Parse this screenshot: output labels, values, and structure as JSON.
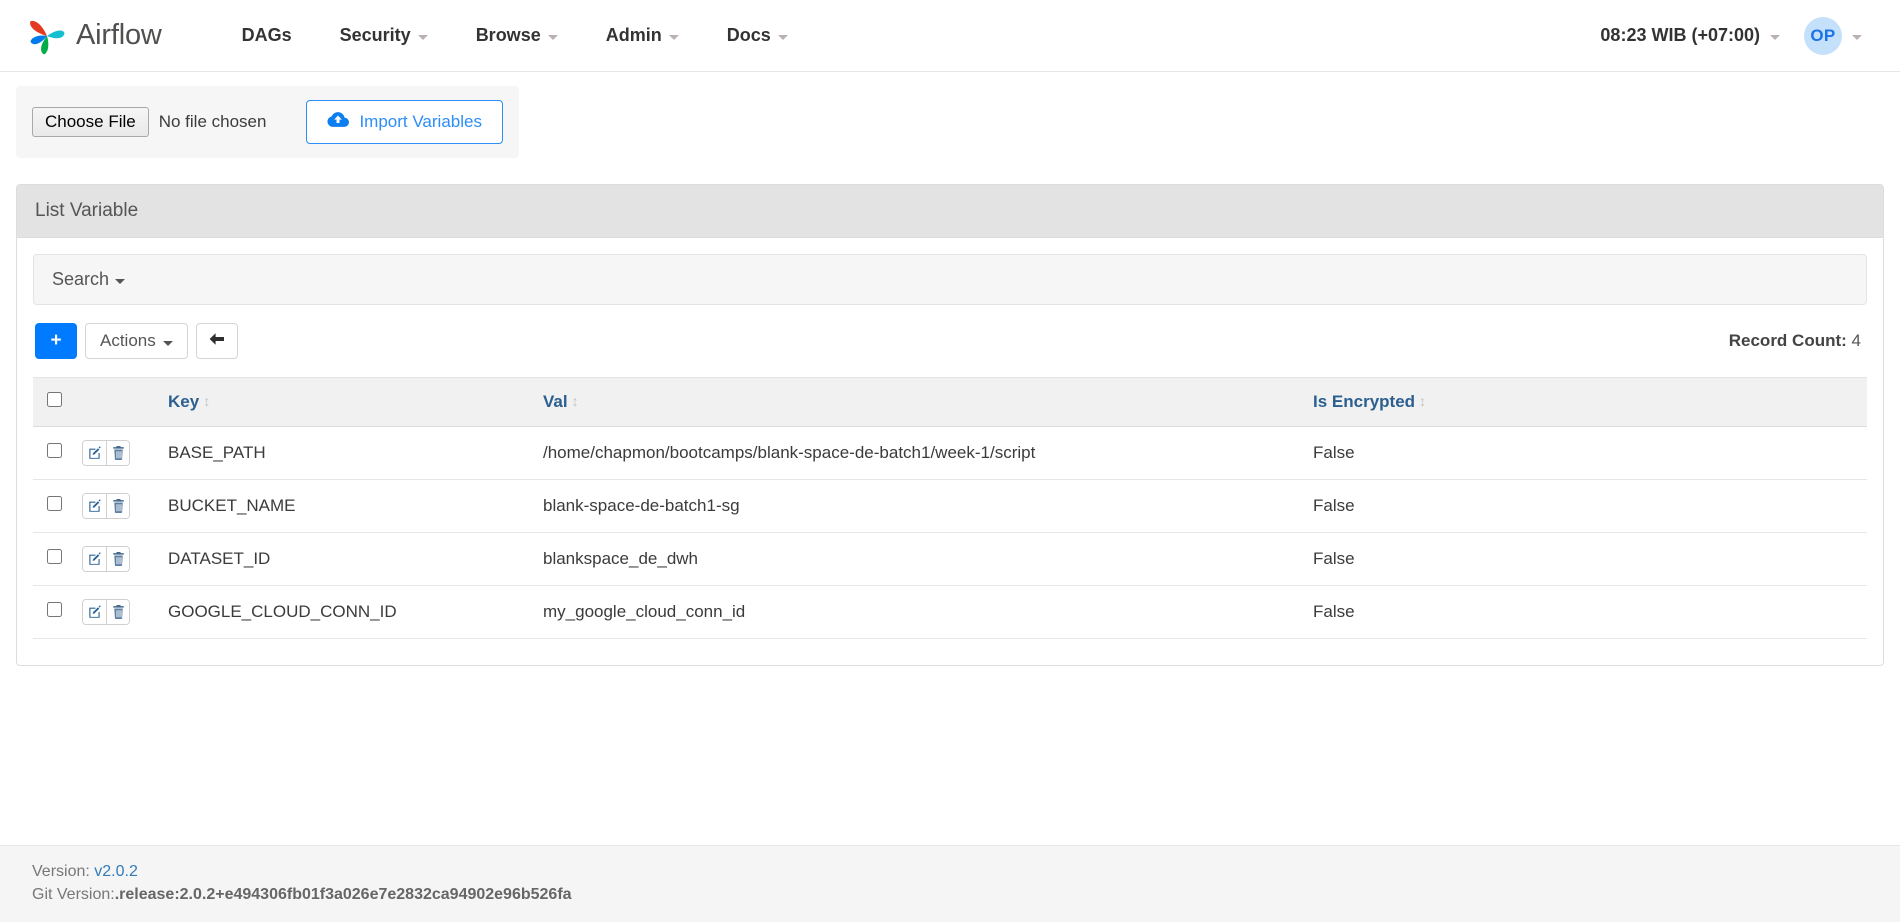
{
  "navbar": {
    "brand_label": "Airflow",
    "brand_logo_icon": "airflow-pinwheel-logo",
    "items": [
      {
        "label": "DAGs",
        "has_caret": false
      },
      {
        "label": "Security",
        "has_caret": true
      },
      {
        "label": "Browse",
        "has_caret": true
      },
      {
        "label": "Admin",
        "has_caret": true
      },
      {
        "label": "Docs",
        "has_caret": true
      }
    ],
    "clock_label": "08:23 WIB (+07:00)",
    "avatar_initials": "OP"
  },
  "import_bar": {
    "choose_file_label": "Choose File",
    "no_file_label": "No file chosen",
    "import_button_label": "Import Variables",
    "import_button_icon": "cloud-upload-icon"
  },
  "panel": {
    "heading": "List Variable",
    "search_label": "Search"
  },
  "toolbar": {
    "add_label": "+",
    "actions_label": "Actions",
    "back_icon": "arrow-left-icon",
    "record_count_label": "Record Count:",
    "record_count_value": "4"
  },
  "table": {
    "columns": [
      {
        "label": "Key",
        "sortable": true
      },
      {
        "label": "Val",
        "sortable": true
      },
      {
        "label": "Is Encrypted",
        "sortable": true
      }
    ],
    "row_actions": {
      "edit_icon": "edit-pencil-icon",
      "delete_icon": "trash-icon"
    },
    "rows": [
      {
        "key": "BASE_PATH",
        "val": "/home/chapmon/bootcamps/blank-space-de-batch1/week-1/script",
        "is_encrypted": "False"
      },
      {
        "key": "BUCKET_NAME",
        "val": "blank-space-de-batch1-sg",
        "is_encrypted": "False"
      },
      {
        "key": "DATASET_ID",
        "val": "blankspace_de_dwh",
        "is_encrypted": "False"
      },
      {
        "key": "GOOGLE_CLOUD_CONN_ID",
        "val": "my_google_cloud_conn_id",
        "is_encrypted": "False"
      }
    ]
  },
  "footer": {
    "version_label": "Version:",
    "version_value": "v2.0.2",
    "git_version_label": "Git Version:",
    "git_version_value": ".release:2.0.2+e494306fb01f3a026e7e2832ca94902e96b526fa"
  },
  "colors": {
    "accent_blue": "#007bff",
    "link_blue": "#337ab7",
    "header_blue": "#2b5f8f",
    "avatar_bg": "#c5e0fb",
    "logo_red": "#e43921",
    "logo_cyan": "#11c0d1",
    "logo_blue": "#017cee",
    "logo_green": "#00ad46"
  }
}
